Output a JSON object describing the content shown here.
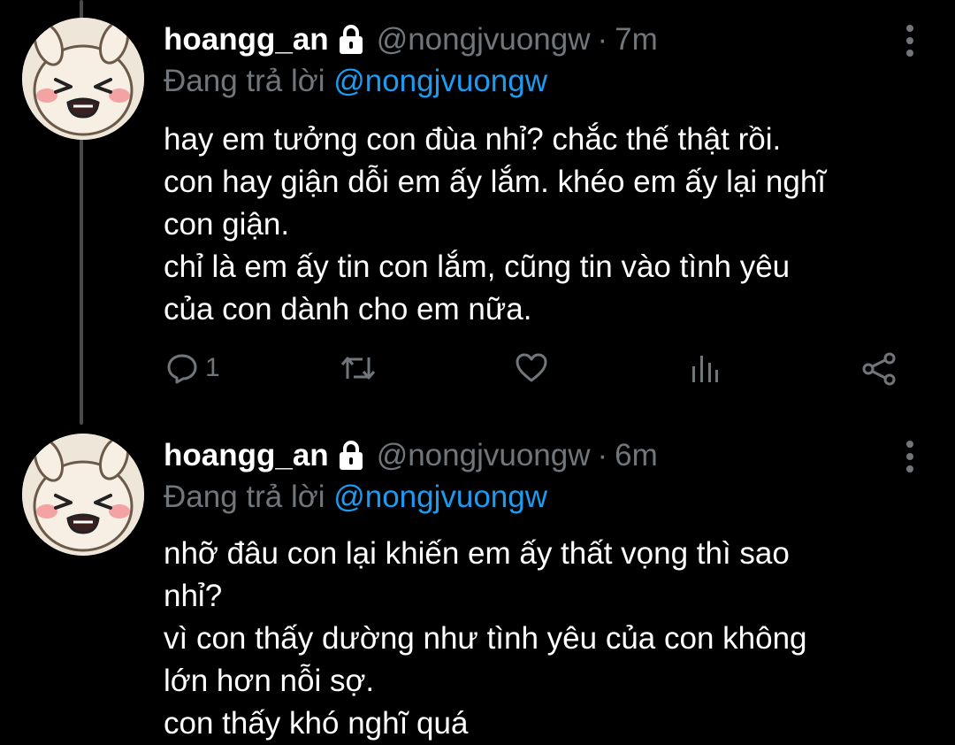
{
  "tweets": [
    {
      "display_name": "hoangg_an",
      "handle": "@nongjvuongw",
      "separator": "·",
      "time": "7m",
      "replying_prefix": "Đang trả lời",
      "replying_to": "@nongjvuongw",
      "lines": [
        "hay em tưởng con đùa nhỉ? chắc thế thật rồi.",
        "con hay giận dỗi em ấy lắm. khéo em ấy lại nghĩ",
        "con giận.",
        "chỉ là em ấy tin con lắm, cũng tin vào tình yêu",
        "của con dành cho em nữa."
      ],
      "reply_count": "1"
    },
    {
      "display_name": "hoangg_an",
      "handle": "@nongjvuongw",
      "separator": "·",
      "time": "6m",
      "replying_prefix": "Đang trả lời",
      "replying_to": "@nongjvuongw",
      "lines": [
        "nhỡ đâu con lại khiến em ấy thất vọng thì sao",
        "nhỉ?",
        "vì con thấy dường như tình yêu của con không",
        "lớn hơn nỗi sợ.",
        "con thấy khó nghĩ quá"
      ]
    }
  ],
  "icons": {
    "lock": "lock-icon",
    "more": "more-vertical-icon",
    "reply": "reply-icon",
    "retweet": "retweet-icon",
    "like": "heart-icon",
    "analytics": "analytics-icon",
    "share": "share-icon"
  },
  "colors": {
    "background": "#000000",
    "text": "#ffffff",
    "muted": "#71767b",
    "mention": "#1d9bf0",
    "thread_line": "#4a4a4a"
  }
}
